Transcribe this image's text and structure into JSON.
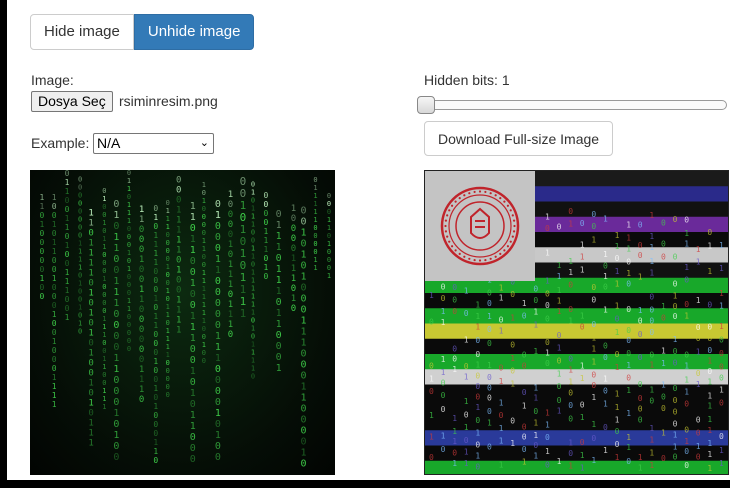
{
  "toolbar": {
    "hide_label": "Hide image",
    "unhide_label": "Unhide image"
  },
  "image_input": {
    "label": "Image:",
    "button_label": "Dosya Seç",
    "file_name": "rsiminresim.png"
  },
  "example": {
    "label": "Example:",
    "selected": "N/A"
  },
  "hidden_bits": {
    "label": "Hidden bits: 1",
    "value": 1,
    "min": 1,
    "max": 8
  },
  "download": {
    "label": "Download Full-size Image"
  },
  "colors": {
    "primary": "#337ab7",
    "matrix_green": "#3fd04a",
    "matrix_bright": "#c8ffc8",
    "seal_red": "#c0242b"
  },
  "stego_bands": [
    "#1a1a1a",
    "#2a2a8a",
    "#111111",
    "#6a2a9a",
    "#0a0a0a",
    "#c8c8c8",
    "#111111",
    "#18a82a",
    "#0a0a0a",
    "#18a82a",
    "#c8c832",
    "#0a0a0a",
    "#18a82a",
    "#d0d0d0",
    "#0a0a0a",
    "#0a0a0a",
    "#0a0a0a",
    "#2a3a9a",
    "#0a0a0a",
    "#18a82a"
  ]
}
